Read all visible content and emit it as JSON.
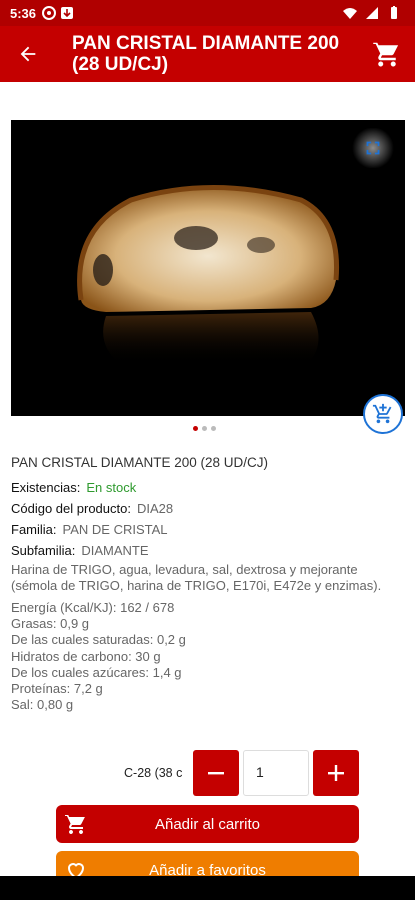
{
  "status": {
    "time": "5:36"
  },
  "appbar": {
    "title": "PAN CRISTAL DIAMANTE 200 (28 UD/CJ)"
  },
  "product": {
    "name": "PAN CRISTAL DIAMANTE 200 (28 UD/CJ)",
    "stock_label": "Existencias:",
    "stock_value": "En stock",
    "code_label": "Código del producto:",
    "code_value": "DIA28",
    "family_label": "Familia:",
    "family_value": "PAN DE CRISTAL",
    "subfamily_label": "Subfamilia:",
    "subfamily_value": "DIAMANTE",
    "ingredients": "Harina de TRIGO, agua, levadura, sal, dextrosa y mejorante (sémola de TRIGO, harina de TRIGO, E170i, E472e y enzimas).",
    "nutrition": [
      "Energía (Kcal/KJ): 162 / 678",
      "Grasas: 0,9 g",
      "De las cuales saturadas: 0,2 g",
      "Hidratos de carbono: 30 g",
      "De los cuales azúcares: 1,4 g",
      "Proteínas: 7,2 g",
      "Sal: 0,80 g"
    ]
  },
  "order": {
    "ref": "C-28 (38 c",
    "minus": "−",
    "plus": "+",
    "quantity": "1",
    "add_cart_label": "Añadir al carrito",
    "add_fav_label": "Añadir a favoritos"
  },
  "gallery": {
    "count": 3,
    "active": 0
  },
  "colors": {
    "brand": "#c40000",
    "fav": "#ef7d00",
    "stock": "#2e9a2e",
    "fab_ring": "#1e73d6"
  }
}
